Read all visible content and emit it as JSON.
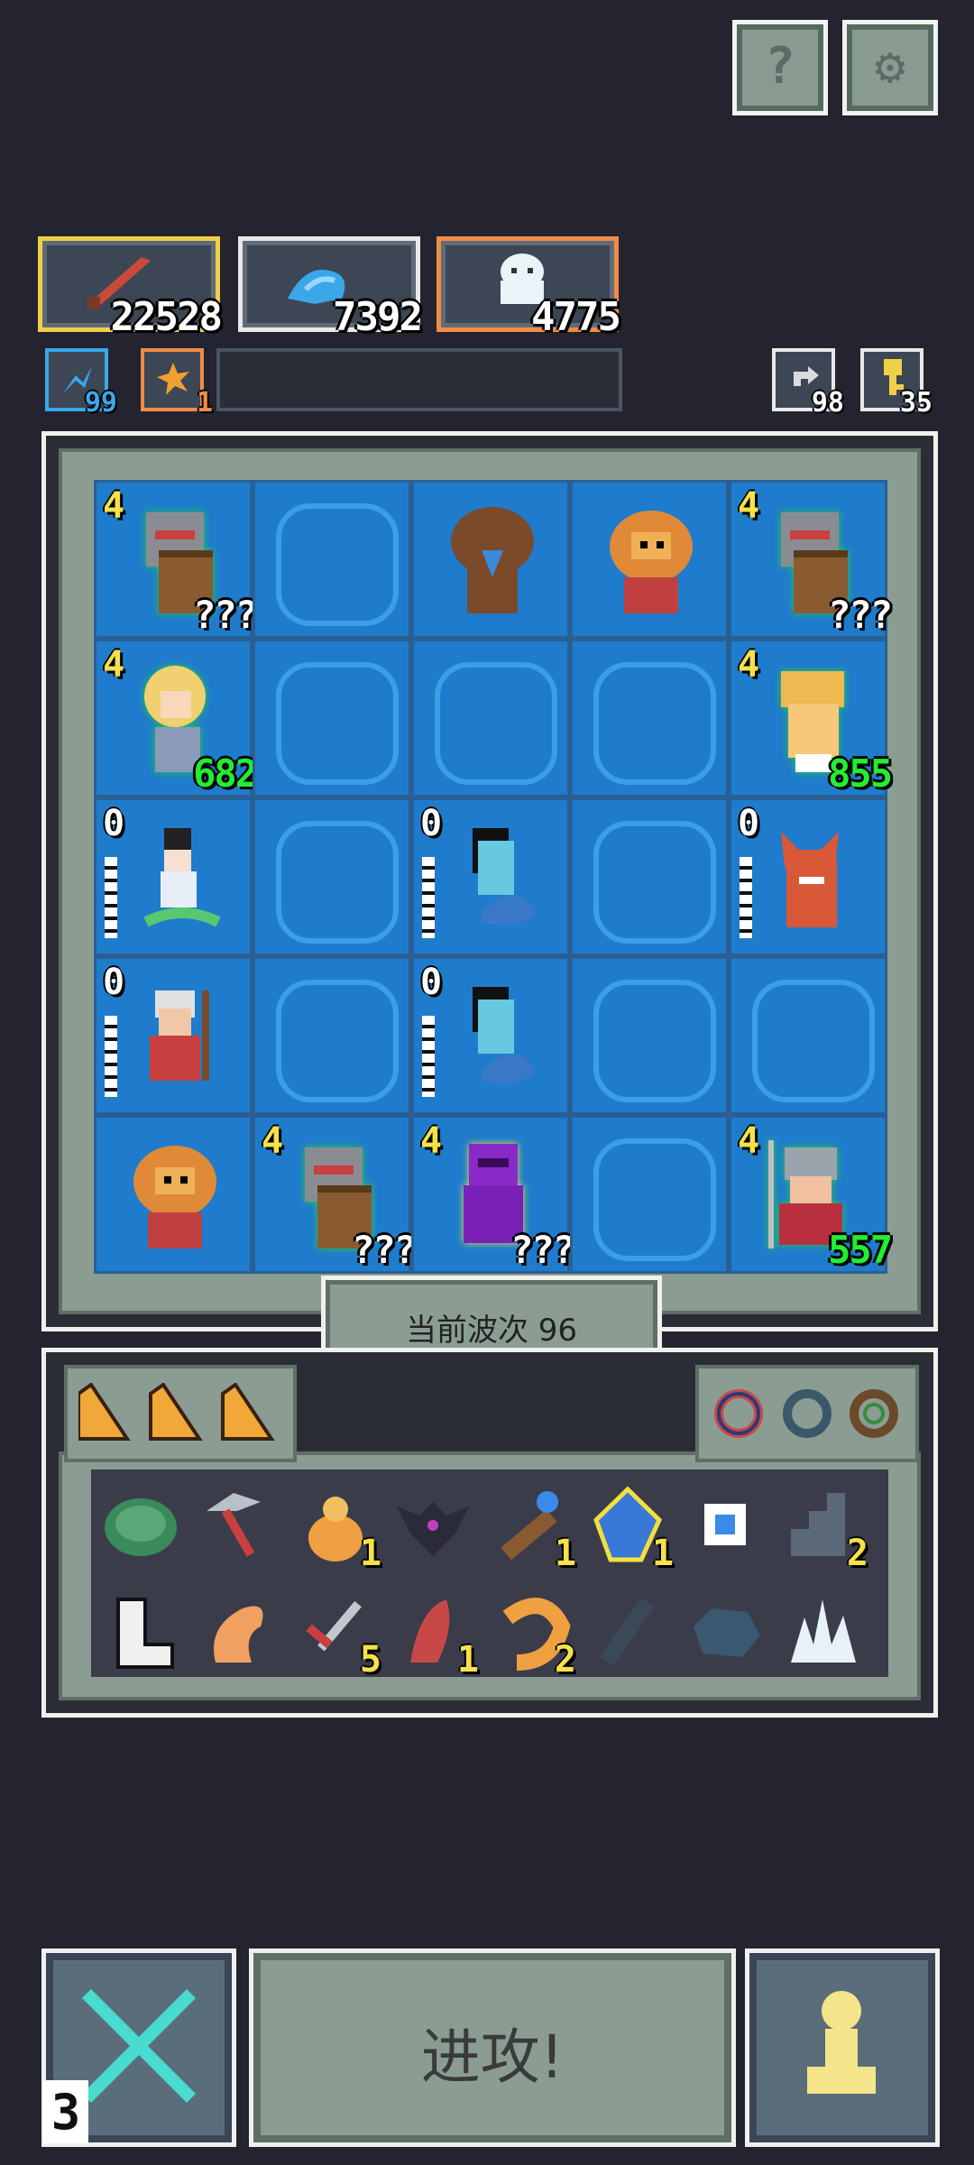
{
  "top_buttons": {
    "help_icon": "question-icon",
    "settings_icon": "gear-icon",
    "help_glyph": "?",
    "settings_glyph": "⚙"
  },
  "resources": {
    "sword": "22528",
    "magic": "7392",
    "ghost": "4775",
    "mana": "99",
    "fire": "1",
    "refresh": "98",
    "key": "35"
  },
  "board": {
    "wave_label": "当前波次 96",
    "cells": [
      {
        "unit": "shield-knight",
        "level": "4",
        "hp": "???",
        "hp_type": "q"
      },
      {
        "unit": "empty"
      },
      {
        "unit": "tree-ent"
      },
      {
        "unit": "lion-beast"
      },
      {
        "unit": "shield-knight",
        "level": "4",
        "hp": "???",
        "hp_type": "q"
      },
      {
        "unit": "blonde-warrior",
        "level": "4",
        "hp": "682",
        "hp_type": "g"
      },
      {
        "unit": "empty"
      },
      {
        "unit": "empty"
      },
      {
        "unit": "empty"
      },
      {
        "unit": "golden-brute",
        "level": "4",
        "hp": "855",
        "hp_type": "g"
      },
      {
        "unit": "snake-lady",
        "level": "0",
        "bars": true
      },
      {
        "unit": "empty"
      },
      {
        "unit": "blue-ghost",
        "level": "0",
        "bars": true
      },
      {
        "unit": "empty"
      },
      {
        "unit": "red-demon",
        "level": "0",
        "bars": true
      },
      {
        "unit": "old-dwarf",
        "level": "0",
        "bars": true
      },
      {
        "unit": "empty"
      },
      {
        "unit": "blue-ghost",
        "level": "0",
        "bars": true
      },
      {
        "unit": "empty"
      },
      {
        "unit": "empty"
      },
      {
        "unit": "lion-beast"
      },
      {
        "unit": "shield-knight",
        "level": "4",
        "hp": "???",
        "hp_type": "q"
      },
      {
        "unit": "purple-knight",
        "level": "4",
        "hp": "???",
        "hp_type": "q"
      },
      {
        "unit": "empty"
      },
      {
        "unit": "armored-soldier",
        "level": "4",
        "hp": "557",
        "hp_type": "g"
      }
    ]
  },
  "inventory": {
    "items": [
      {
        "icon": "turtle-shell-icon",
        "count": ""
      },
      {
        "icon": "pickaxe-icon",
        "count": ""
      },
      {
        "icon": "flame-idol-icon",
        "count": "1"
      },
      {
        "icon": "shadow-bat-icon",
        "count": ""
      },
      {
        "icon": "wooden-staff-icon",
        "count": "1"
      },
      {
        "icon": "blue-crystal-icon",
        "count": "1"
      },
      {
        "icon": "mirror-icon",
        "count": ""
      },
      {
        "icon": "stone-stairs-icon",
        "count": "2"
      },
      {
        "icon": "white-boot-icon",
        "count": ""
      },
      {
        "icon": "fox-tail-icon",
        "count": ""
      },
      {
        "icon": "dagger-icon",
        "count": "5"
      },
      {
        "icon": "red-claw-icon",
        "count": "1"
      },
      {
        "icon": "shrimp-icon",
        "count": "2"
      },
      {
        "icon": "spyglass-icon",
        "count": ""
      },
      {
        "icon": "ore-chunk-icon",
        "count": ""
      },
      {
        "icon": "ice-crystal-icon",
        "count": ""
      }
    ]
  },
  "bottom": {
    "attack_label": "进攻!",
    "turn_counter": "3"
  },
  "colors": {
    "bg": "#232430",
    "tile": "#1f7ccc",
    "hp_green": "#22ee33",
    "level_yellow": "#f5e14a"
  }
}
